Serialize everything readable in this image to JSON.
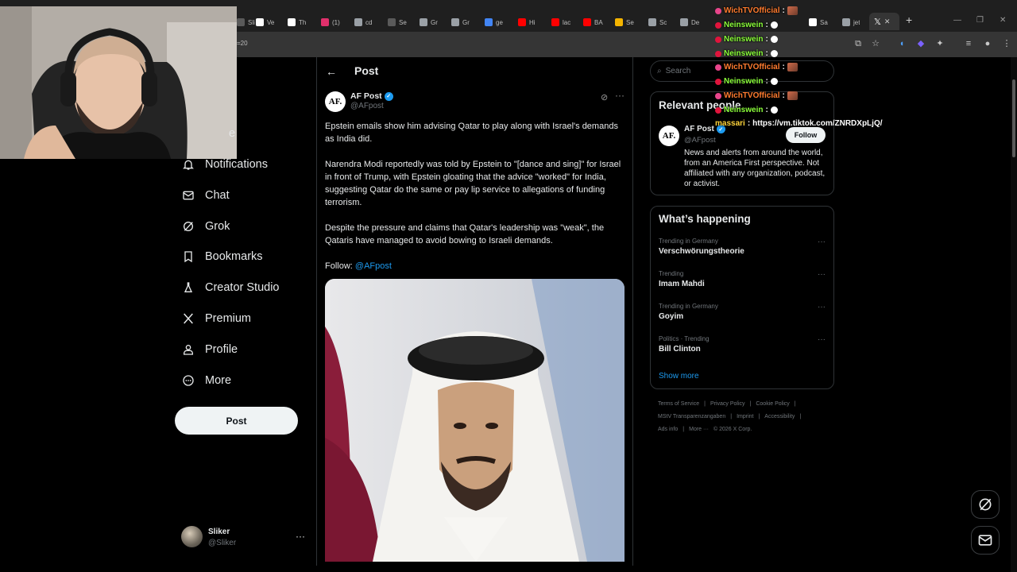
{
  "browser": {
    "tabs": [
      {
        "label": "Sli",
        "color": "#5a5a5a"
      },
      {
        "label": "Ve",
        "color": "#ffffff"
      },
      {
        "label": "Th",
        "color": "#ffffff"
      },
      {
        "label": "(1)",
        "color": "#e1306c"
      },
      {
        "label": "cd",
        "color": "#9aa0a6"
      },
      {
        "label": "Se",
        "color": "#5a5a5a"
      },
      {
        "label": "Gr",
        "color": "#9aa0a6"
      },
      {
        "label": "Gr",
        "color": "#9aa0a6"
      },
      {
        "label": "ge",
        "color": "#4285f4"
      },
      {
        "label": "Hi",
        "color": "#ff0000"
      },
      {
        "label": "lac",
        "color": "#ff0000"
      },
      {
        "label": "BA",
        "color": "#ff0000"
      },
      {
        "label": "Se",
        "color": "#f4b400"
      },
      {
        "label": "Sc",
        "color": "#9aa0a6"
      },
      {
        "label": "De",
        "color": "#9aa0a6"
      },
      {
        "label": "Sa",
        "color": "#ffffff"
      },
      {
        "label": "jet",
        "color": "#9aa0a6"
      }
    ],
    "url_fragment": "=20",
    "new_tab_label": "+"
  },
  "chat_overlay": [
    {
      "user": "WichTVOfficial",
      "color": "#ff7b2e",
      "badge": "#e8458b",
      "kind": "emote-img"
    },
    {
      "user": "Neinswein",
      "color": "#8bff3a",
      "badge": "#e0143c",
      "kind": "bubble"
    },
    {
      "user": "Neinswein",
      "color": "#8bff3a",
      "badge": "#e0143c",
      "kind": "bubble"
    },
    {
      "user": "Neinswein",
      "color": "#8bff3a",
      "badge": "#e0143c",
      "kind": "bubble"
    },
    {
      "user": "WichTVOfficial",
      "color": "#ff7b2e",
      "badge": "#e8458b",
      "kind": "emote-img"
    },
    {
      "user": "Neinswein",
      "color": "#8bff3a",
      "badge": "#e0143c",
      "kind": "bubble"
    },
    {
      "user": "WichTVOfficial",
      "color": "#ff7b2e",
      "badge": "#e8458b",
      "kind": "emote-img"
    },
    {
      "user": "Neinswein",
      "color": "#8bff3a",
      "badge": "#e0143c",
      "kind": "bubble"
    },
    {
      "user": "massari",
      "color": "#ffd43b",
      "badge": "",
      "kind": "text",
      "text": "https://vm.tiktok.com/ZNRDXpLjQ/"
    }
  ],
  "nav": {
    "partial_home": "e",
    "items": [
      {
        "label": "Notifications",
        "icon": "bell-icon"
      },
      {
        "label": "Chat",
        "icon": "mail-icon"
      },
      {
        "label": "Grok",
        "icon": "grok-icon"
      },
      {
        "label": "Bookmarks",
        "icon": "bookmark-icon"
      },
      {
        "label": "Creator Studio",
        "icon": "flask-icon"
      },
      {
        "label": "Premium",
        "icon": "x-logo-icon"
      },
      {
        "label": "Profile",
        "icon": "person-icon"
      },
      {
        "label": "More",
        "icon": "more-circle-icon"
      }
    ],
    "post_button": "Post",
    "account": {
      "name": "Sliker",
      "handle": "@Sliker"
    }
  },
  "post": {
    "header": "Post",
    "author": {
      "name": "AF Post",
      "handle": "@AFpost",
      "avatar_text": "AF."
    },
    "paragraphs": [
      "Epstein emails show him advising Qatar to play along with Israel's demands as India did.",
      "Narendra Modi reportedly was told by Epstein to \"[dance and sing]\" for Israel in front of Trump, with Epstein gloating that the advice \"worked\" for India, suggesting Qatar do the same or pay lip service to allegations of funding terrorism.",
      "Despite the pressure and claims that Qatar's leadership was \"weak\", the Qataris have managed to avoid bowing to Israeli demands."
    ],
    "follow_prefix": "Follow: ",
    "follow_handle": "@AFpost"
  },
  "right": {
    "search_placeholder": "Search",
    "relevant_title": "Relevant people",
    "relevant": {
      "name": "AF Post",
      "handle": "@AFpost",
      "avatar_text": "AF.",
      "follow_label": "Follow",
      "bio": "News and alerts from around the world, from an America First perspective. Not affiliated with any organization, podcast, or activist."
    },
    "happening_title": "What’s happening",
    "trends": [
      {
        "context": "Trending in Germany",
        "title": "Verschwörungstheorie"
      },
      {
        "context": "Trending",
        "title": "Imam Mahdi"
      },
      {
        "context": "Trending in Germany",
        "title": "Goyim"
      },
      {
        "context": "Politics · Trending",
        "title": "Bill Clinton"
      }
    ],
    "show_more": "Show more",
    "footer_lines": [
      [
        "Terms of Service",
        "|",
        "Privacy Policy",
        "|",
        "Cookie Policy",
        "|"
      ],
      [
        "MStV Transparenzangaben",
        "|",
        "Imprint",
        "|",
        "Accessibility",
        "|"
      ],
      [
        "Ads info",
        "|",
        "More ···",
        "© 2026 X Corp."
      ]
    ]
  },
  "colors": {
    "accent": "#1d9bf0",
    "border": "#2f3336",
    "muted": "#71767b"
  }
}
